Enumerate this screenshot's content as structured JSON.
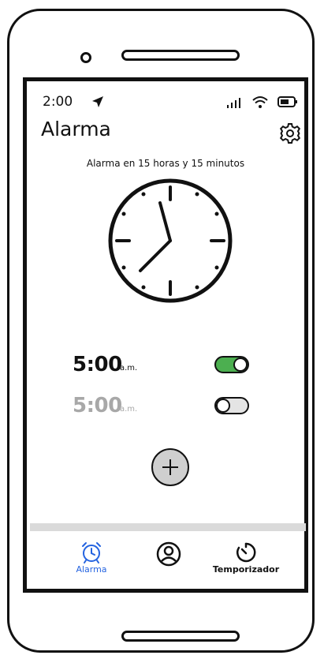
{
  "status_bar": {
    "time": "2:00"
  },
  "header": {
    "title": "Alarma"
  },
  "summary": {
    "text": "Alarma en 15 horas y 15 minutos"
  },
  "alarms": [
    {
      "time": "5:00",
      "period": "a.m.",
      "enabled": true
    },
    {
      "time": "5:00",
      "period": "a.m.",
      "enabled": false
    }
  ],
  "nav": {
    "items": [
      {
        "label": "Alarma",
        "icon": "alarm-clock-icon",
        "active": true
      },
      {
        "label": "",
        "icon": "profile-icon",
        "active": false
      },
      {
        "label": "Temporizador",
        "icon": "timer-icon",
        "active": false
      }
    ]
  },
  "colors": {
    "accent": "#2463e0",
    "toggle_on": "#4caf50",
    "toggle_off": "#e4e4e4",
    "add_button": "#cfcfcf",
    "inactive_text": "#a8a8a8"
  }
}
